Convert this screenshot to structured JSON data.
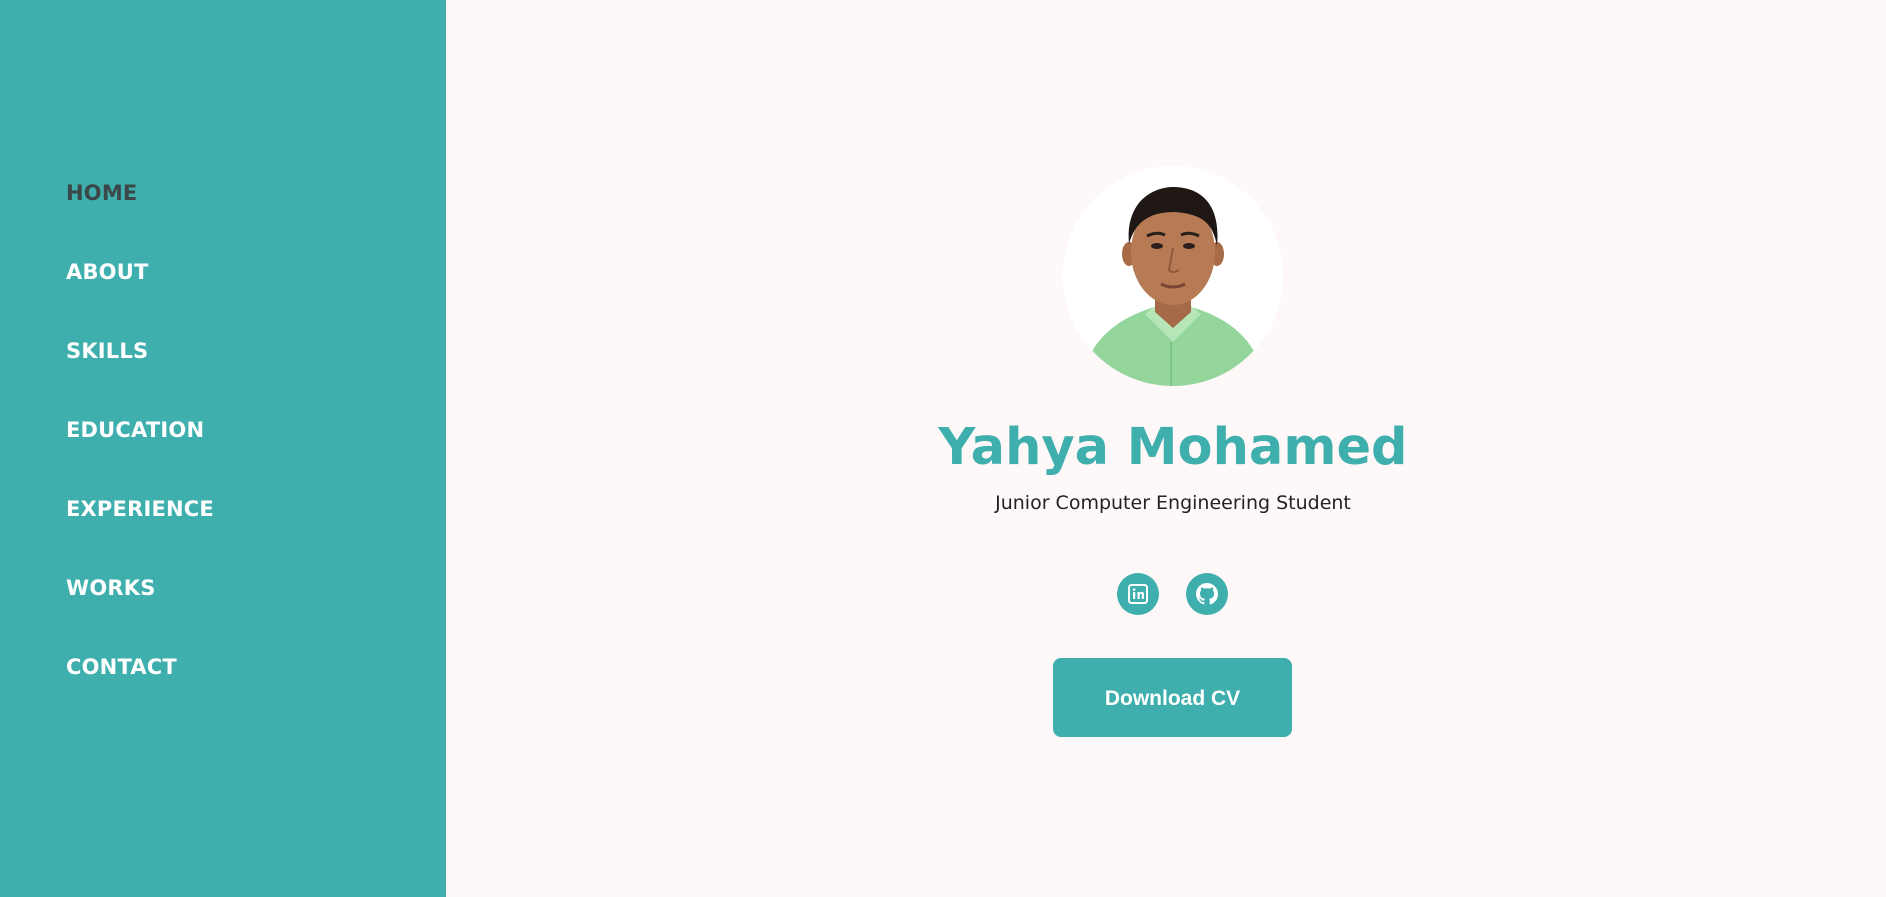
{
  "sidebar": {
    "items": [
      {
        "label": "HOME",
        "active": true
      },
      {
        "label": "ABOUT"
      },
      {
        "label": "SKILLS"
      },
      {
        "label": "EDUCATION"
      },
      {
        "label": "EXPERIENCE"
      },
      {
        "label": "WORKS"
      },
      {
        "label": "CONTACT"
      }
    ]
  },
  "profile": {
    "photo": "profile-photo",
    "name": "Yahya Mohamed",
    "title": "Junior Computer Engineering Student"
  },
  "social": [
    {
      "icon": "linkedin-icon"
    },
    {
      "icon": "github-icon"
    }
  ],
  "actions": {
    "download_cv_label": "Download CV"
  },
  "colors": {
    "accent": "#3eafad",
    "background": "#fff8f8",
    "active_nav": "#3b4748"
  }
}
